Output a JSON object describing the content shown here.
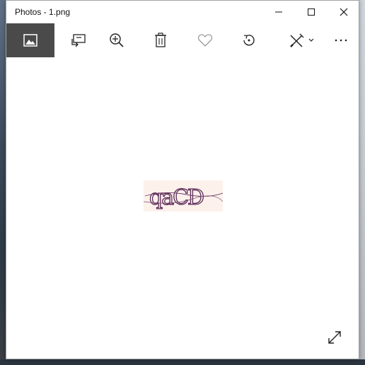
{
  "window": {
    "title": "Photos - 1.png"
  },
  "titlebar_buttons": [
    "minimize-icon",
    "maximize-icon",
    "close-icon"
  ],
  "toolbar": {
    "items": [
      {
        "icon": "image-icon",
        "active": true
      },
      {
        "icon": "slideshow-icon"
      },
      {
        "icon": "zoom-in-icon"
      },
      {
        "icon": "delete-icon"
      },
      {
        "icon": "heart-icon"
      },
      {
        "icon": "rotate-icon"
      },
      {
        "icon": "edit-draw-icon"
      },
      {
        "icon": "more-icon"
      }
    ]
  },
  "image": {
    "text": "qaCD"
  },
  "colors": {
    "active_tool_bg": "#4a4a4a",
    "image_bg": "#fdf1ec"
  }
}
